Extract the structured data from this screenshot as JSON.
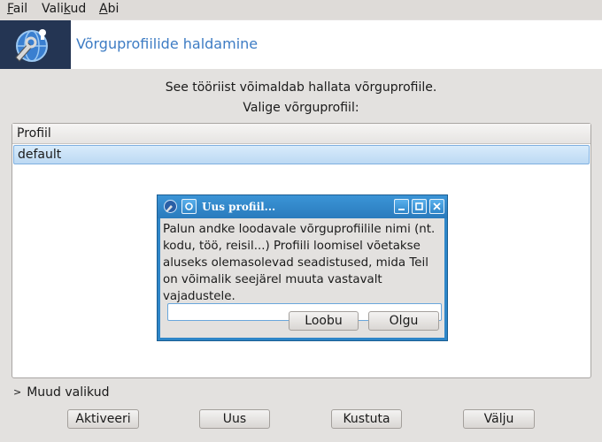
{
  "menubar": {
    "items": [
      {
        "label": "Fail",
        "mnemonic": "F",
        "rest": "ail"
      },
      {
        "label": "Valikud",
        "mnemonic": "Vali",
        "rest": "kud",
        "underline_index": 4
      },
      {
        "label": "Abi",
        "mnemonic": "A",
        "rest": "bi"
      }
    ]
  },
  "header": {
    "title": "Võrguprofiilide haldamine",
    "icon": "network-profiles-icon"
  },
  "description": {
    "line1": "See tööriist võimaldab hallata võrguprofiile.",
    "line2": "Valige võrguprofiil:"
  },
  "profile_list": {
    "column_header": "Profiil",
    "rows": [
      "default"
    ],
    "selected": "default"
  },
  "dialog": {
    "title": "Uus profiil...",
    "message": "Palun andke loodavale võrguprofiilile nimi (nt. kodu, töö, reisil...) Profiili loomisel võetakse aluseks olemasolevad seadistused, mida Teil on võimalik seejärel muuta vastavalt vajadustele.",
    "input_value": "",
    "cancel_label": "Loobu",
    "ok_label": "Olgu"
  },
  "expander": {
    "label": "Muud valikud"
  },
  "buttons": {
    "activate": "Aktiveeri",
    "new": "Uus",
    "delete": "Kustuta",
    "quit": "Välju"
  },
  "colors": {
    "accent": "#3d7cc4",
    "dialog_frame": "#2e86c8",
    "selection": "#bcd9f3",
    "background": "#e3e1df"
  }
}
